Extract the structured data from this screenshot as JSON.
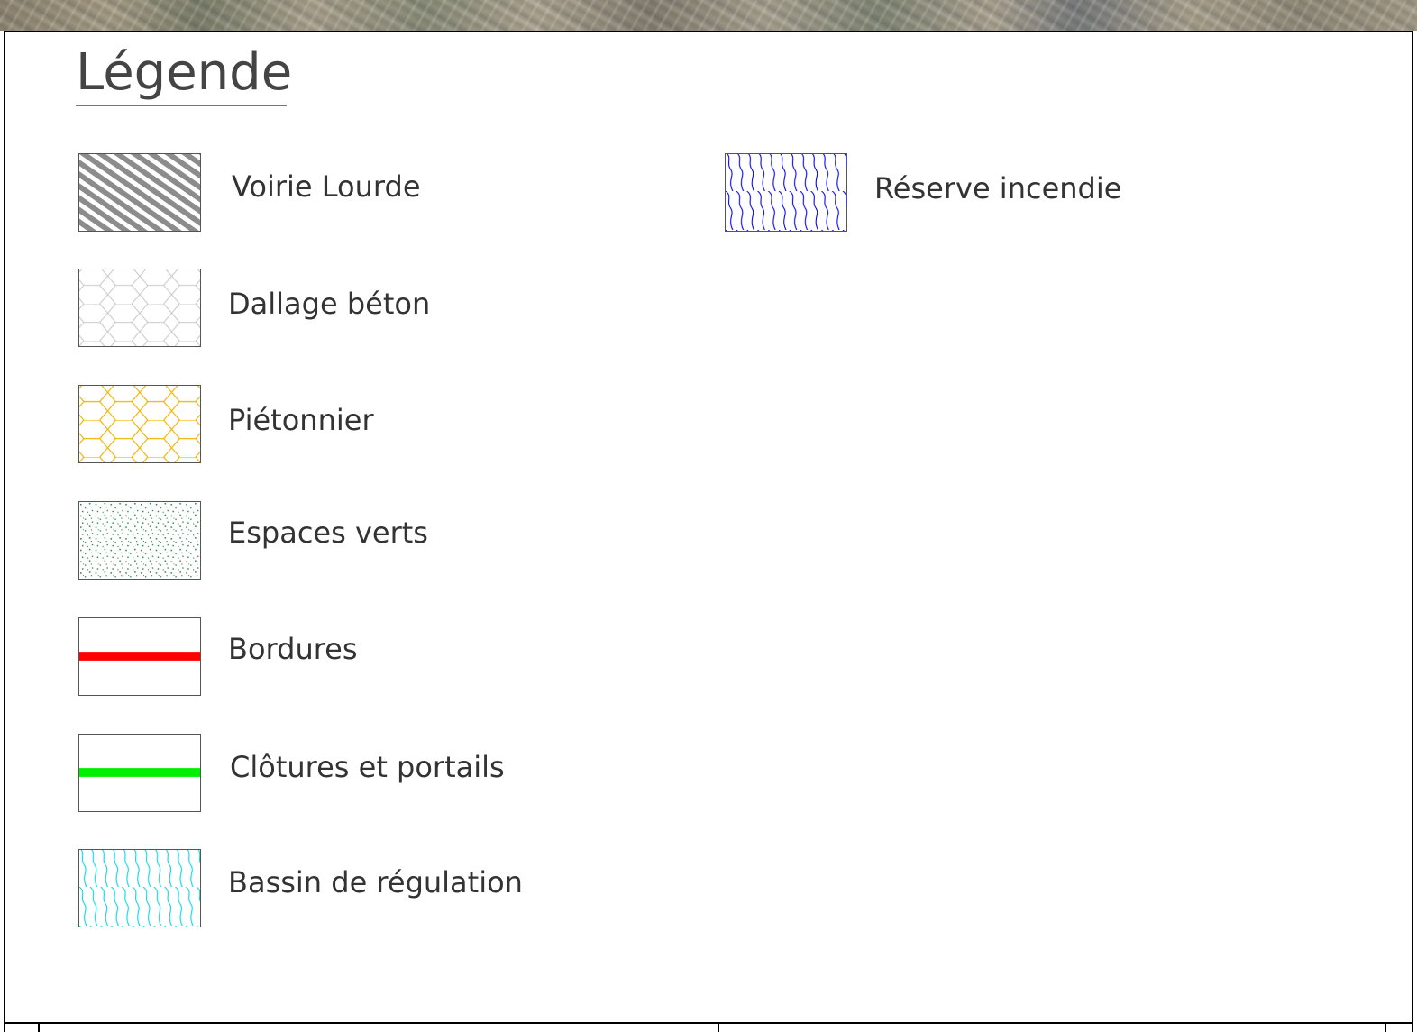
{
  "legend": {
    "title": "Légende",
    "items": [
      {
        "label": "Voirie Lourde",
        "pattern": "diagonal-hatch",
        "color": "#8c8c8c"
      },
      {
        "label": "Dallage béton",
        "pattern": "hexagon-grid",
        "color": "#c8c8c8"
      },
      {
        "label": "Piétonnier",
        "pattern": "hexagon-grid",
        "color": "#f0b400"
      },
      {
        "label": "Espaces verts",
        "pattern": "stipple",
        "color": "#2e8b57"
      },
      {
        "label": "Bordures",
        "pattern": "horizontal-line",
        "color": "#ff0000"
      },
      {
        "label": "Clôtures et portails",
        "pattern": "horizontal-line",
        "color": "#00ee00"
      },
      {
        "label": "Bassin de régulation",
        "pattern": "wave-lines",
        "color": "#00d8e8"
      },
      {
        "label": "Réserve incendie",
        "pattern": "wave-lines",
        "color": "#0000ee"
      }
    ]
  }
}
